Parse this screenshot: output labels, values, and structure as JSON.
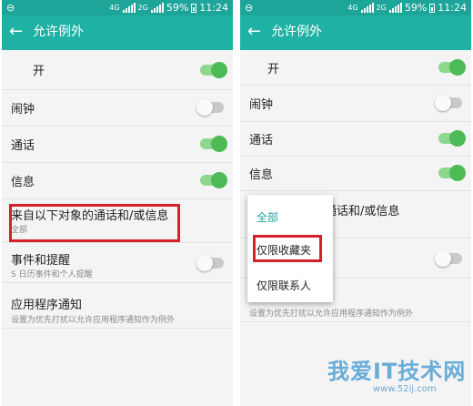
{
  "status_bar": {
    "left_icon": "minus-circle-icon",
    "battery_pct": "59%",
    "time": "11:24",
    "network_label": "4G",
    "network_label_2": "2G"
  },
  "app_bar": {
    "title": "允许例外",
    "back_icon": "←"
  },
  "left_screen": {
    "master_label": "开",
    "alarm_label": "闹钟",
    "calls_label": "通话",
    "messages_label": "信息",
    "from_label": "来自以下对象的通话和/或信息",
    "from_sub": "全部",
    "events_label": "事件和提醒",
    "events_sub": "S 日历事件和个人提醒",
    "app_notif_label": "应用程序通知",
    "app_notif_sub": "设置为优先打扰以允许应用程序通知作为例外"
  },
  "right_screen": {
    "master_label": "开",
    "alarm_label": "闹钟",
    "calls_label": "通话",
    "messages_label": "信息",
    "from_label_partial": "通话和/或信息",
    "app_notif_sub": "设置为优先打扰以允许应用程序通知作为例外"
  },
  "popup": {
    "options": [
      "全部",
      "仅限收藏夹",
      "仅限联系人"
    ],
    "selected_index": 0
  },
  "switches": {
    "master": true,
    "alarm": false,
    "calls": true,
    "messages": true,
    "events": false
  },
  "colors": {
    "app_bar": "#1fb2a4",
    "status_bar": "#1ea59a",
    "switch_on": "#4cbb55",
    "highlight": "#d6202a",
    "selected_option": "#1fa5a0"
  },
  "watermark": {
    "text": "我爱IT技术网",
    "url": "www.52ij.com"
  }
}
